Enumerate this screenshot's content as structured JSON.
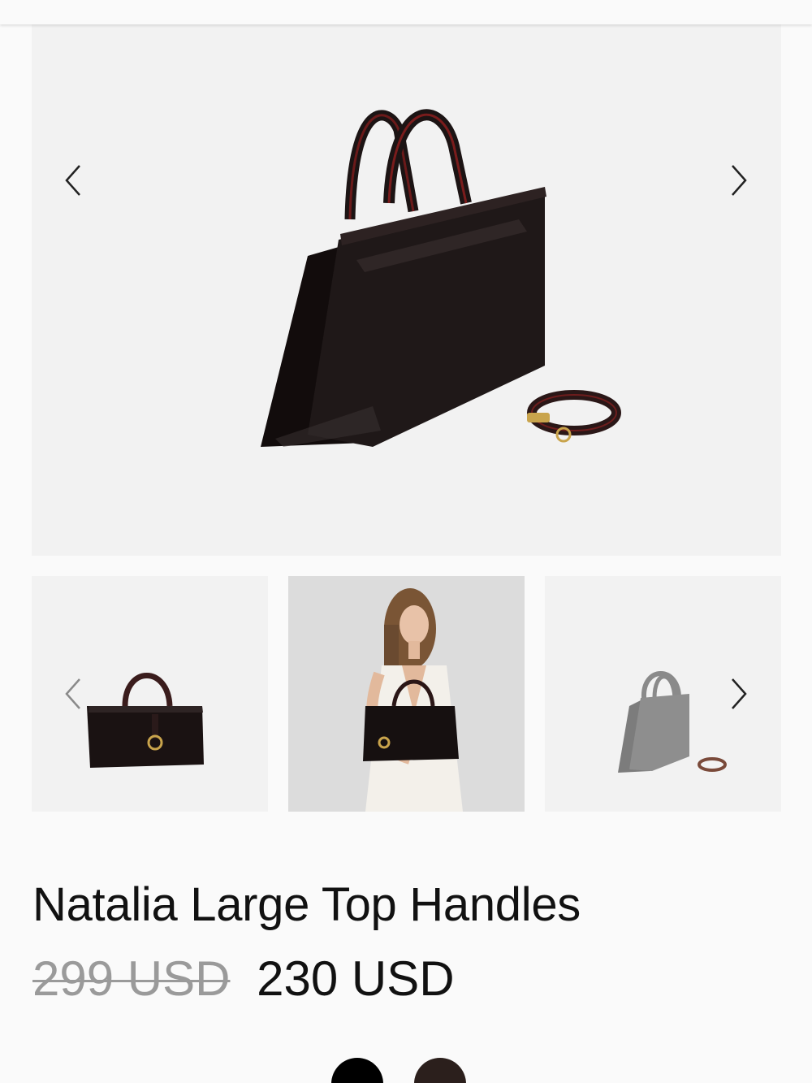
{
  "product": {
    "title": "Natalia Large Top Handles",
    "old_price": "299 USD",
    "new_price": "230 USD"
  },
  "gallery": {
    "main_image": "patent-leather-handbag-with-strap",
    "thumbnails": [
      {
        "image": "handbag-front-view"
      },
      {
        "image": "model-holding-handbag"
      },
      {
        "image": "handbag-side-view-with-strap"
      }
    ]
  },
  "colors": {
    "swatches": [
      "#000000",
      "#2b1f1c"
    ],
    "background": "#f2f2f2"
  },
  "icons": {
    "prev": "chevron-left-icon",
    "next": "chevron-right-icon"
  }
}
